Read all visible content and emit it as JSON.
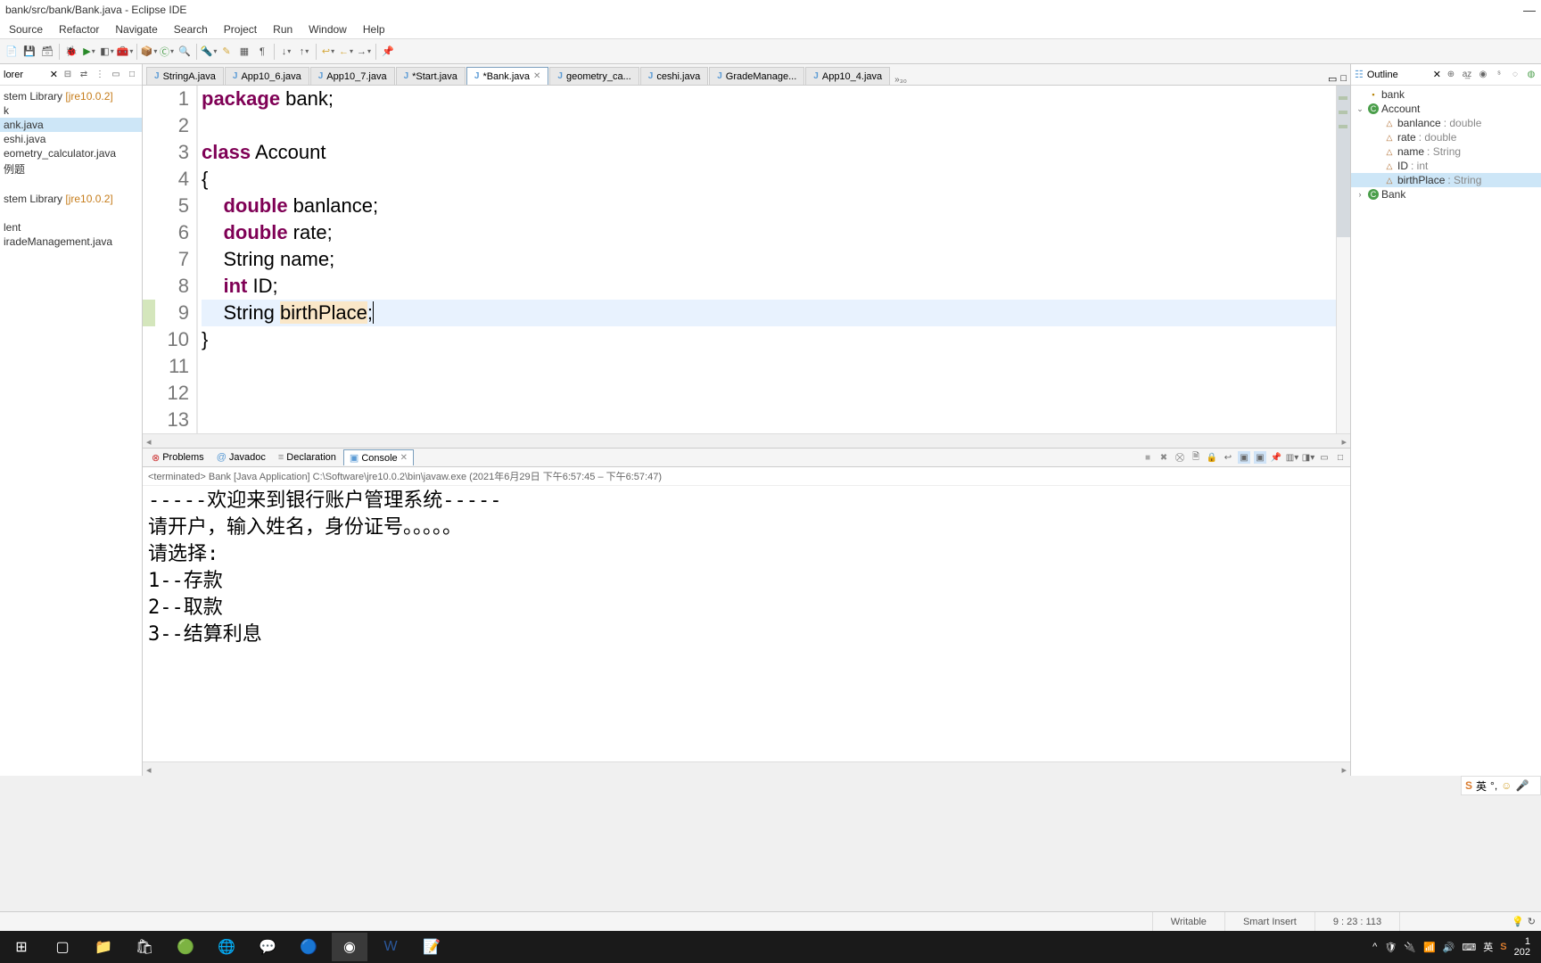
{
  "window": {
    "title": "bank/src/bank/Bank.java - Eclipse IDE"
  },
  "menu": {
    "source": "Source",
    "refactor": "Refactor",
    "navigate": "Navigate",
    "search": "Search",
    "project": "Project",
    "run": "Run",
    "window": "Window",
    "help": "Help"
  },
  "explorer": {
    "title": "lorer",
    "items": [
      {
        "label": "stem Library",
        "jre": "[jre10.0.2]",
        "type": "lib"
      },
      {
        "label": "k",
        "type": "pkg"
      },
      {
        "label": "ank.java",
        "type": "java",
        "selected": true
      },
      {
        "label": "eshi.java",
        "type": "java"
      },
      {
        "label": "eometry_calculator.java",
        "type": "java"
      },
      {
        "label": "例题",
        "type": "pkg"
      },
      {
        "label": "",
        "type": "spacer"
      },
      {
        "label": "stem Library",
        "jre": "[jre10.0.2]",
        "type": "lib"
      },
      {
        "label": "",
        "type": "spacer"
      },
      {
        "label": "lent",
        "type": "pkg"
      },
      {
        "label": "iradeManagement.java",
        "type": "java"
      }
    ]
  },
  "tabs": [
    {
      "name": "StringA.java",
      "active": false
    },
    {
      "name": "App10_6.java",
      "active": false
    },
    {
      "name": "App10_7.java",
      "active": false
    },
    {
      "name": "*Start.java",
      "active": false
    },
    {
      "name": "*Bank.java",
      "active": true,
      "close": true
    },
    {
      "name": "geometry_ca...",
      "active": false
    },
    {
      "name": "ceshi.java",
      "active": false
    },
    {
      "name": "GradeManage...",
      "active": false
    },
    {
      "name": "App10_4.java",
      "active": false
    }
  ],
  "tabs_overflow": "»₃₀",
  "code": {
    "lines": [
      {
        "n": 1,
        "tokens": [
          {
            "t": "package",
            "k": true
          },
          {
            "t": " bank;"
          }
        ]
      },
      {
        "n": 2,
        "tokens": []
      },
      {
        "n": 3,
        "tokens": [
          {
            "t": "class",
            "k": true
          },
          {
            "t": " Account"
          }
        ]
      },
      {
        "n": 4,
        "tokens": [
          {
            "t": "{"
          }
        ]
      },
      {
        "n": 5,
        "tokens": [
          {
            "t": "    "
          },
          {
            "t": "double",
            "k": true
          },
          {
            "t": " banlance;"
          }
        ]
      },
      {
        "n": 6,
        "tokens": [
          {
            "t": "    "
          },
          {
            "t": "double",
            "k": true
          },
          {
            "t": " rate;"
          }
        ]
      },
      {
        "n": 7,
        "tokens": [
          {
            "t": "    String name;"
          }
        ]
      },
      {
        "n": 8,
        "tokens": [
          {
            "t": "    "
          },
          {
            "t": "int",
            "k": true
          },
          {
            "t": " ID;"
          }
        ]
      },
      {
        "n": 9,
        "tokens": [
          {
            "t": "    String "
          },
          {
            "t": "birthPlace",
            "hl": true
          },
          {
            "t": ";"
          }
        ],
        "current": true,
        "marker": true
      },
      {
        "n": 10,
        "tokens": [
          {
            "t": "}"
          }
        ]
      },
      {
        "n": 11,
        "tokens": []
      },
      {
        "n": 12,
        "tokens": []
      },
      {
        "n": 13,
        "tokens": []
      }
    ]
  },
  "outline": {
    "title": "Outline",
    "items": [
      {
        "indent": 0,
        "icon": "pkg",
        "name": "bank"
      },
      {
        "indent": 0,
        "tw": "⌄",
        "icon": "cls",
        "name": "Account"
      },
      {
        "indent": 1,
        "icon": "fld",
        "name": "banlance",
        "type": ": double"
      },
      {
        "indent": 1,
        "icon": "fld",
        "name": "rate",
        "type": ": double"
      },
      {
        "indent": 1,
        "icon": "fld",
        "name": "name",
        "type": ": String"
      },
      {
        "indent": 1,
        "icon": "fld",
        "name": "ID",
        "type": ": int"
      },
      {
        "indent": 1,
        "icon": "fld",
        "name": "birthPlace",
        "type": ": String",
        "selected": true
      },
      {
        "indent": 0,
        "tw": "›",
        "icon": "cls",
        "name": "Bank"
      }
    ]
  },
  "bottom": {
    "tabs": {
      "problems": "Problems",
      "javadoc": "Javadoc",
      "declaration": "Declaration",
      "console": "Console"
    },
    "status": "<terminated> Bank [Java Application] C:\\Software\\jre10.0.2\\bin\\javaw.exe  (2021年6月29日 下午6:57:45 – 下午6:57:47)",
    "output": "-----欢迎来到银行账户管理系统-----\n请开户，输入姓名，身份证号。。。。。\n请选择:\n1--存款\n2--取款\n3--结算利息"
  },
  "status": {
    "writable": "Writable",
    "insert": "Smart Insert",
    "pos": "9 : 23 : 113"
  },
  "ime": {
    "label": "英"
  },
  "tray": {
    "lang": "英",
    "time": "1",
    "date": "202"
  }
}
